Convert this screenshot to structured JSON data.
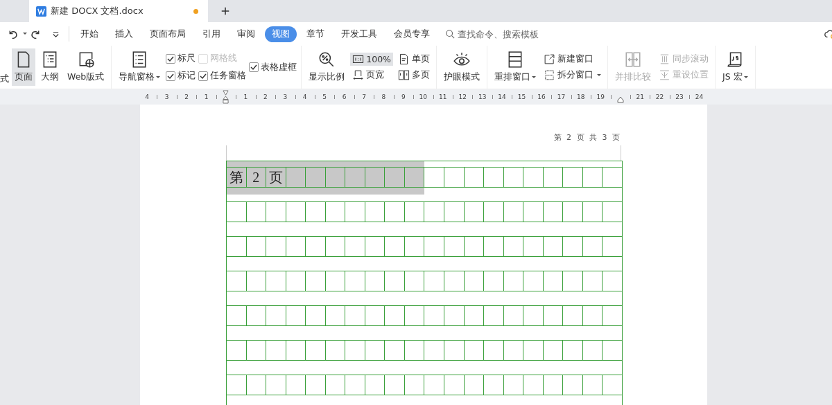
{
  "tabs": [
    {
      "title": "新建 DOCX 文档.docx",
      "selected": true,
      "modified": true
    }
  ],
  "menu": [
    {
      "label": "开始",
      "selected": false
    },
    {
      "label": "插入",
      "selected": false
    },
    {
      "label": "页面布局",
      "selected": false
    },
    {
      "label": "引用",
      "selected": false
    },
    {
      "label": "审阅",
      "selected": false
    },
    {
      "label": "视图",
      "selected": true
    },
    {
      "label": "章节",
      "selected": false
    },
    {
      "label": "开发工具",
      "selected": false
    },
    {
      "label": "会员专享",
      "selected": false
    }
  ],
  "search": {
    "placeholder": "查找命令、搜索模板"
  },
  "ribbon": [
    {
      "columns": [
        [
          {
            "kind": "fragment",
            "label": "式"
          }
        ],
        [
          {
            "kind": "large",
            "label": "页面",
            "selected": true
          }
        ],
        [
          {
            "kind": "large",
            "label": "大纲",
            "selected": false
          }
        ],
        [
          {
            "kind": "large",
            "label": "Web版式",
            "selected": false
          }
        ]
      ]
    },
    {
      "columns": [
        [
          {
            "kind": "large",
            "label": "导航窗格",
            "dropdown": true
          }
        ],
        [
          {
            "kind": "checkbox",
            "label": "标尺",
            "checked": true,
            "disabled": false
          },
          {
            "kind": "checkbox",
            "label": "标记",
            "checked": true,
            "disabled": false
          }
        ],
        [
          {
            "kind": "checkbox",
            "label": "网格线",
            "checked": false,
            "disabled": true
          },
          {
            "kind": "checkbox",
            "label": "任务窗格",
            "checked": true,
            "disabled": false
          }
        ],
        [
          {
            "kind": "checkbox",
            "label": "表格虚框",
            "checked": true,
            "disabled": false
          }
        ]
      ]
    },
    {
      "columns": [
        [
          {
            "kind": "large",
            "label": "显示比例"
          }
        ],
        [
          {
            "kind": "small",
            "label": "100%",
            "selected": true
          },
          {
            "kind": "small",
            "label": "页宽",
            "selected": false
          }
        ],
        [
          {
            "kind": "small",
            "label": "单页",
            "selected": false
          },
          {
            "kind": "small",
            "label": "多页",
            "selected": false
          }
        ]
      ]
    },
    {
      "columns": [
        [
          {
            "kind": "large",
            "label": "护眼模式"
          }
        ]
      ]
    },
    {
      "columns": [
        [
          {
            "kind": "large",
            "label": "重排窗口",
            "dropdown": true
          }
        ],
        [
          {
            "kind": "small",
            "label": "新建窗口"
          },
          {
            "kind": "small",
            "label": "拆分窗口",
            "dropdown": true
          }
        ]
      ]
    },
    {
      "columns": [
        [
          {
            "kind": "large",
            "label": "并排比较",
            "disabled": true
          }
        ],
        [
          {
            "kind": "small",
            "label": "同步滚动",
            "disabled": true
          },
          {
            "kind": "small",
            "label": "重设位置",
            "disabled": true
          }
        ]
      ]
    },
    {
      "columns": [
        [
          {
            "kind": "large",
            "label": "JS 宏",
            "dropdown": true
          }
        ]
      ]
    }
  ],
  "ruler": [
    {
      "kind": "number",
      "label": "4"
    },
    {
      "kind": "number",
      "label": "3"
    },
    {
      "kind": "number",
      "label": "2"
    },
    {
      "kind": "number",
      "label": "1"
    },
    {
      "kind": "indent"
    },
    {
      "kind": "number",
      "label": "1"
    },
    {
      "kind": "number",
      "label": "2"
    },
    {
      "kind": "number",
      "label": "3"
    },
    {
      "kind": "number",
      "label": "4"
    },
    {
      "kind": "number",
      "label": "5"
    },
    {
      "kind": "number",
      "label": "6"
    },
    {
      "kind": "number",
      "label": "7"
    },
    {
      "kind": "number",
      "label": "8"
    },
    {
      "kind": "number",
      "label": "9"
    },
    {
      "kind": "number",
      "label": "10"
    },
    {
      "kind": "number",
      "label": "11"
    },
    {
      "kind": "number",
      "label": "12"
    },
    {
      "kind": "number",
      "label": "13"
    },
    {
      "kind": "number",
      "label": "14"
    },
    {
      "kind": "number",
      "label": "15"
    },
    {
      "kind": "number",
      "label": "16"
    },
    {
      "kind": "number",
      "label": "17"
    },
    {
      "kind": "number",
      "label": "18"
    },
    {
      "kind": "number",
      "label": "19"
    },
    {
      "kind": "margin"
    },
    {
      "kind": "number",
      "label": "21"
    },
    {
      "kind": "number",
      "label": "22"
    },
    {
      "kind": "number",
      "label": "23"
    },
    {
      "kind": "number",
      "label": "24"
    }
  ],
  "page": {
    "header": "第 2 页 共 3 页",
    "first_row": [
      {
        "text": "第",
        "selected": true
      },
      {
        "text": "2",
        "selected": true
      },
      {
        "text": "页",
        "selected": true
      },
      {
        "selected": true
      },
      {
        "selected": true
      },
      {
        "selected": true
      },
      {
        "selected": true
      },
      {
        "selected": true
      },
      {
        "selected": true
      },
      {
        "selected": true
      },
      {
        "selected": false
      },
      {
        "selected": false
      },
      {
        "selected": false
      },
      {
        "selected": false
      },
      {
        "selected": false
      },
      {
        "selected": false
      },
      {
        "selected": false
      },
      {
        "selected": false
      },
      {
        "selected": false
      },
      {
        "selected": false
      }
    ]
  }
}
